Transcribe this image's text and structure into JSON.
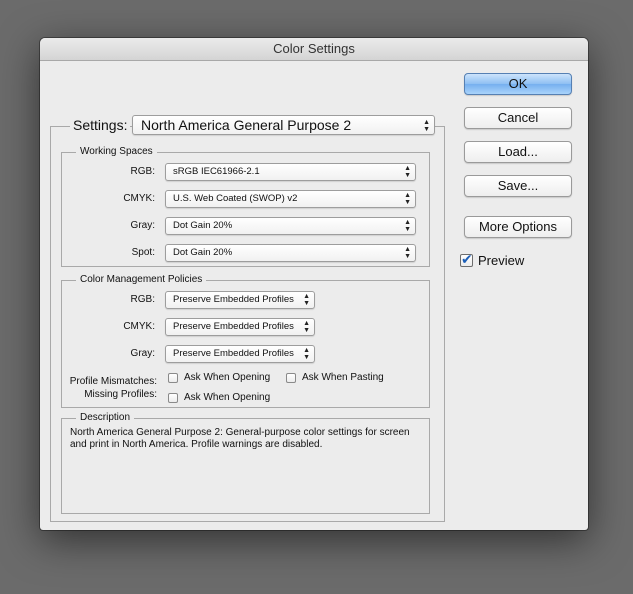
{
  "window": {
    "title": "Color Settings"
  },
  "settings": {
    "label": "Settings:",
    "value": "North America General Purpose 2"
  },
  "working_spaces": {
    "legend": "Working Spaces",
    "rgb": {
      "label": "RGB:",
      "value": "sRGB IEC61966-2.1"
    },
    "cmyk": {
      "label": "CMYK:",
      "value": "U.S. Web Coated (SWOP) v2"
    },
    "gray": {
      "label": "Gray:",
      "value": "Dot Gain 20%"
    },
    "spot": {
      "label": "Spot:",
      "value": "Dot Gain 20%"
    }
  },
  "policies": {
    "legend": "Color Management Policies",
    "rgb": {
      "label": "RGB:",
      "value": "Preserve Embedded Profiles"
    },
    "cmyk": {
      "label": "CMYK:",
      "value": "Preserve Embedded Profiles"
    },
    "gray": {
      "label": "Gray:",
      "value": "Preserve Embedded Profiles"
    },
    "profile_mismatches_label": "Profile Mismatches:",
    "missing_profiles_label": "Missing Profiles:",
    "ask_when_opening": {
      "label": "Ask When Opening",
      "checked": false
    },
    "ask_when_pasting": {
      "label": "Ask When Pasting",
      "checked": false
    },
    "missing_ask_when_opening": {
      "label": "Ask When Opening",
      "checked": false
    }
  },
  "description": {
    "legend": "Description",
    "text": "North America General Purpose 2:  General-purpose color settings for screen and print in North America. Profile warnings are disabled."
  },
  "buttons": {
    "ok": "OK",
    "cancel": "Cancel",
    "load": "Load...",
    "save": "Save...",
    "more_options": "More Options"
  },
  "preview": {
    "label": "Preview",
    "checked": true
  },
  "glyphs": {
    "up_arrow": "▲",
    "down_arrow": "▼",
    "check": "✔"
  },
  "colors": {
    "default_button": "#8ebff3",
    "check_blue": "#1d5fb8"
  }
}
